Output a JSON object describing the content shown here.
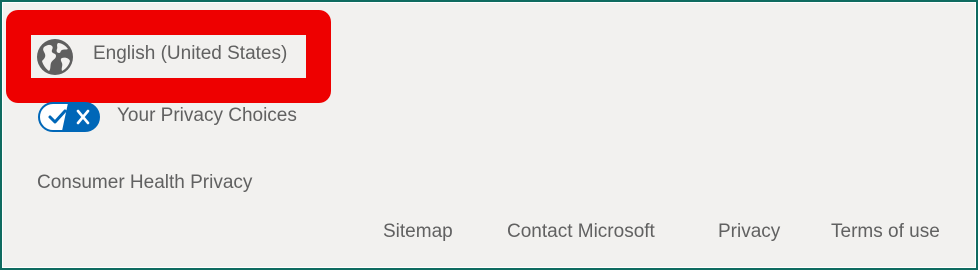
{
  "language": {
    "label": "English (United States)",
    "icon": "globe-icon"
  },
  "privacy_choices": {
    "label": "Your Privacy Choices",
    "icon": "privacy-toggle-icon",
    "color": "#0067b8"
  },
  "consumer_health": {
    "label": "Consumer Health Privacy"
  },
  "footer_links": {
    "sitemap": "Sitemap",
    "contact": "Contact Microsoft",
    "privacy": "Privacy",
    "terms": "Terms of use"
  },
  "colors": {
    "background": "#f2f1ef",
    "highlight": "#ee0000",
    "border": "#0f6b60",
    "text": "#616161"
  }
}
